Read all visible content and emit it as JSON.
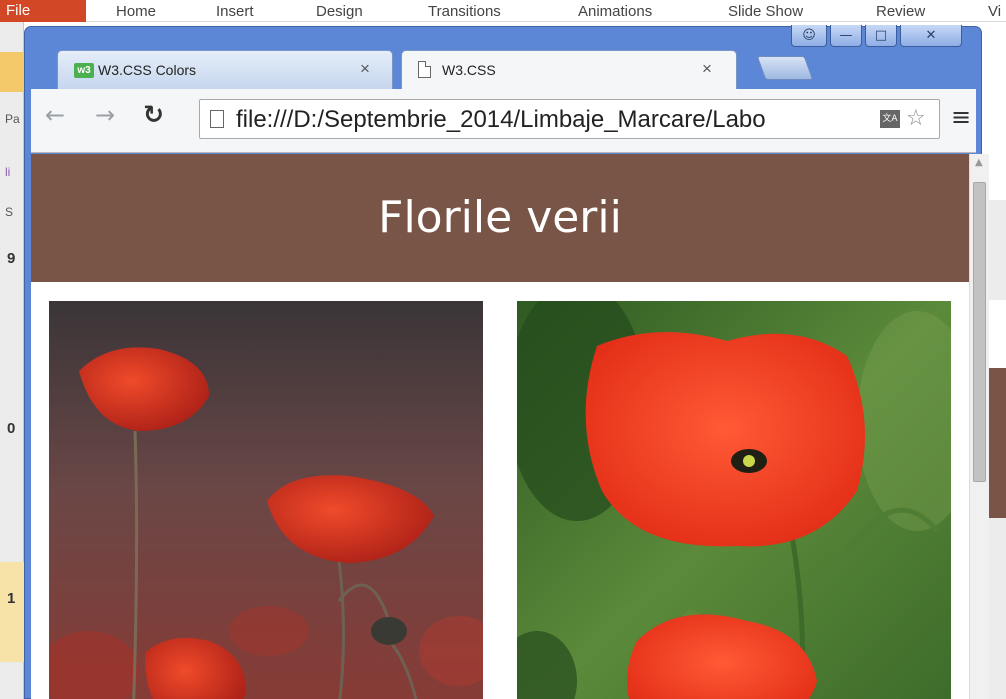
{
  "background_app": {
    "file_label": "File",
    "ribbon_tabs": [
      "Home",
      "Insert",
      "Design",
      "Transitions",
      "Animations",
      "Slide Show",
      "Review",
      "Vi"
    ],
    "side_marks": [
      "9",
      "0",
      "1"
    ],
    "side_small": [
      "Pa",
      "li",
      "S"
    ]
  },
  "browser": {
    "tabs": [
      {
        "title": "W3.CSS Colors",
        "favicon": "w3-favicon",
        "favicon_text": "w3",
        "active": false
      },
      {
        "title": "W3.CSS",
        "favicon": "page-icon",
        "active": true
      }
    ],
    "tab_close_glyph": "×",
    "caption_buttons": [
      "user-icon",
      "minimize-icon",
      "maximize-icon",
      "close-icon"
    ],
    "url": "file:///D:/Septembrie_2014/Limbaje_Marcare/Labo"
  },
  "page": {
    "header_title": "Florile verii",
    "header_color": "#795548",
    "photos": [
      {
        "name": "poppies-dark-background"
      },
      {
        "name": "poppy-green-background"
      }
    ]
  }
}
